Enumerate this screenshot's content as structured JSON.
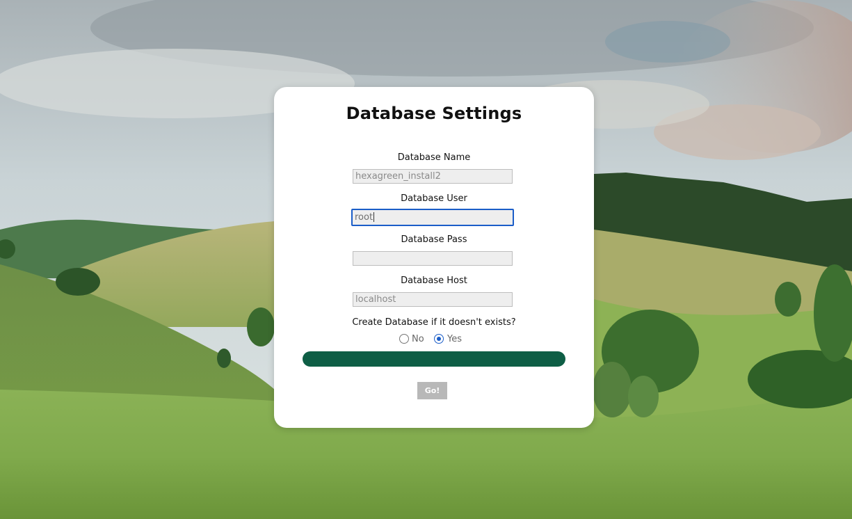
{
  "form": {
    "title": "Database Settings",
    "fields": [
      {
        "label": "Database Name",
        "value": "hexagreen_install2"
      },
      {
        "label": "Database User",
        "value": "root"
      },
      {
        "label": "Database Pass",
        "value": ""
      },
      {
        "label": "Database Host",
        "value": "localhost"
      }
    ],
    "create_db": {
      "question": "Create Database if it doesn't exists?",
      "options": [
        "No",
        "Yes"
      ],
      "selected": "Yes"
    },
    "progress": 1.0,
    "submit_label": "Go!"
  },
  "colors": {
    "progress": "#0e5e45",
    "focus": "#1a5dc8",
    "button": "#b8b8b8"
  }
}
